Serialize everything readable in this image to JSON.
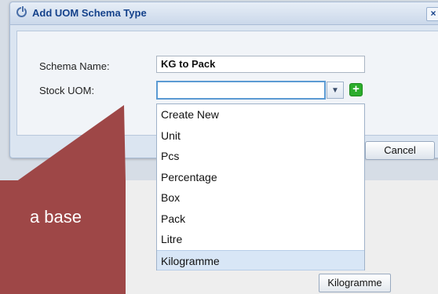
{
  "dialog": {
    "title": "Add UOM Schema Type",
    "close_label": "×",
    "schema_name_label": "Schema Name:",
    "schema_name_value": "KG to Pack",
    "stock_uom_label": "Stock UOM:",
    "stock_uom_value": "",
    "trigger_glyph": "▼",
    "add_glyph": "+",
    "cancel_label": "Cancel"
  },
  "dropdown": {
    "items": [
      "Create New",
      "Unit",
      "Pcs",
      "Percentage",
      "Box",
      "Pack",
      "Litre",
      "Kilogramme"
    ],
    "highlighted": "Kilogramme"
  },
  "callout": {
    "text": "a base"
  },
  "background_button": {
    "label": "Kilogramme"
  },
  "colors": {
    "title": "#15428b",
    "callout": "#9e4747",
    "focus_border": "#5b9ad3",
    "add_icon": "#2cad2c",
    "selected_row": "#d8e6f6"
  }
}
